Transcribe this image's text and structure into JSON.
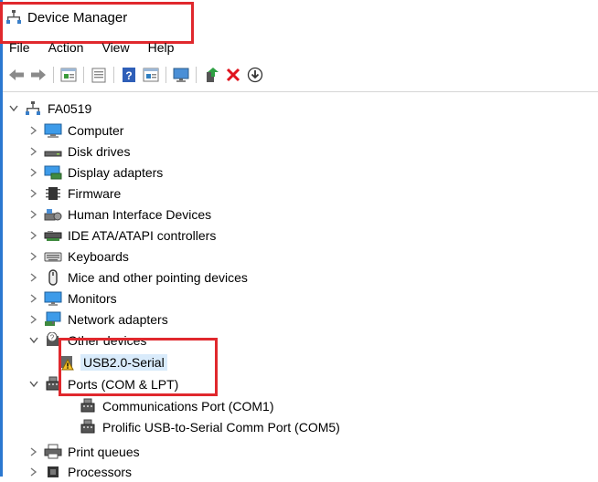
{
  "window": {
    "title": "Device Manager"
  },
  "menu": [
    {
      "label": "File"
    },
    {
      "label": "Action"
    },
    {
      "label": "View"
    },
    {
      "label": "Help"
    }
  ],
  "toolbar": {
    "buttons": [
      "back-icon",
      "forward-icon",
      "properties-icon",
      "show-hidden-icon",
      "help-icon",
      "action-pane-icon",
      "monitor-icon",
      "update-driver-icon",
      "uninstall-icon",
      "download-icon"
    ]
  },
  "tree": {
    "root": {
      "label": "FA0519",
      "expanded": true
    },
    "categories": [
      {
        "label": "Computer",
        "icon": "computer-icon",
        "expanded": false
      },
      {
        "label": "Disk drives",
        "icon": "disk-drive-icon",
        "expanded": false
      },
      {
        "label": "Display adapters",
        "icon": "display-adapter-icon",
        "expanded": false
      },
      {
        "label": "Firmware",
        "icon": "firmware-icon",
        "expanded": false
      },
      {
        "label": "Human Interface Devices",
        "icon": "hid-icon",
        "expanded": false
      },
      {
        "label": "IDE ATA/ATAPI controllers",
        "icon": "ide-controller-icon",
        "expanded": false
      },
      {
        "label": "Keyboards",
        "icon": "keyboard-icon",
        "expanded": false
      },
      {
        "label": "Mice and other pointing devices",
        "icon": "mouse-icon",
        "expanded": false
      },
      {
        "label": "Monitors",
        "icon": "monitor-icon",
        "expanded": false
      },
      {
        "label": "Network adapters",
        "icon": "network-adapter-icon",
        "expanded": false
      },
      {
        "label": "Other devices",
        "icon": "other-devices-icon",
        "expanded": true
      },
      {
        "label": "USB2.0-Serial",
        "icon": "warning-device-icon",
        "child": true,
        "selected": true
      },
      {
        "label": "Ports (COM & LPT)",
        "icon": "port-icon",
        "expanded": true
      },
      {
        "label": "Communications Port (COM1)",
        "icon": "port-icon",
        "child": true
      },
      {
        "label": "Prolific USB-to-Serial Comm Port (COM5)",
        "icon": "port-icon",
        "child": true
      },
      {
        "label": "Print queues",
        "icon": "printer-icon",
        "expanded": false
      },
      {
        "label": "Processors",
        "icon": "processor-icon",
        "expanded": false
      }
    ]
  },
  "colors": {
    "annotation": "#e0282d",
    "selection": "#d9ebfb",
    "accent": "#2b78d0"
  }
}
